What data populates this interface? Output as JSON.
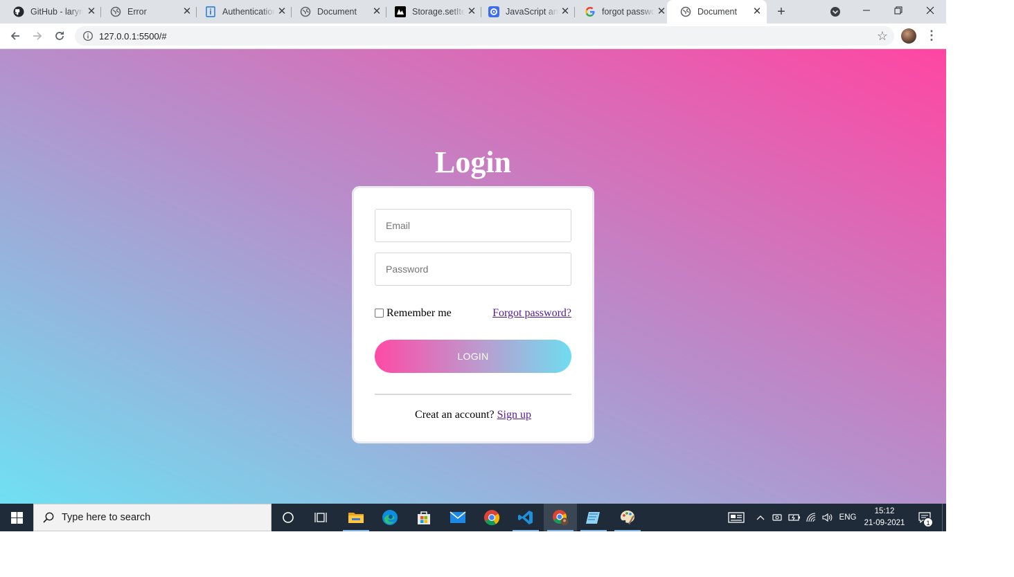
{
  "browser": {
    "tabs": [
      {
        "title": "GitHub - larym",
        "icon": "github-icon"
      },
      {
        "title": "Error",
        "icon": "globe-icon"
      },
      {
        "title": "Authentication",
        "icon": "doc-info-icon"
      },
      {
        "title": "Document",
        "icon": "globe-icon"
      },
      {
        "title": "Storage.setItem",
        "icon": "mdn-icon"
      },
      {
        "title": "JavaScript and",
        "icon": "js-site-icon"
      },
      {
        "title": "forgot passwo",
        "icon": "google-icon"
      },
      {
        "title": "Document",
        "icon": "globe-icon",
        "active": true
      }
    ],
    "address": "127.0.0.1:5500/#"
  },
  "page": {
    "title": "Login",
    "email_placeholder": "Email",
    "password_placeholder": "Password",
    "remember_label": "Remember me",
    "forgot_label": "Forgot password?",
    "login_label": "LOGIN",
    "signup_prompt": "Creat an account?",
    "signup_link": "Sign up",
    "colors": {
      "gradient_start": "#6fe0f2",
      "gradient_mid": "#b68fcb",
      "gradient_end": "#ff46a2",
      "link": "#551a8b"
    }
  },
  "taskbar": {
    "search_placeholder": "Type here to search",
    "apps": [
      "cortana-icon",
      "task-view-icon",
      "file-explorer-icon",
      "edge-icon",
      "store-icon",
      "mail-icon",
      "chrome-icon",
      "vscode-icon",
      "chrome-profile-icon",
      "notepad-icon",
      "paint-icon"
    ],
    "language": "ENG",
    "time": "15:12",
    "date": "21-09-2021",
    "notification_count": "1"
  }
}
